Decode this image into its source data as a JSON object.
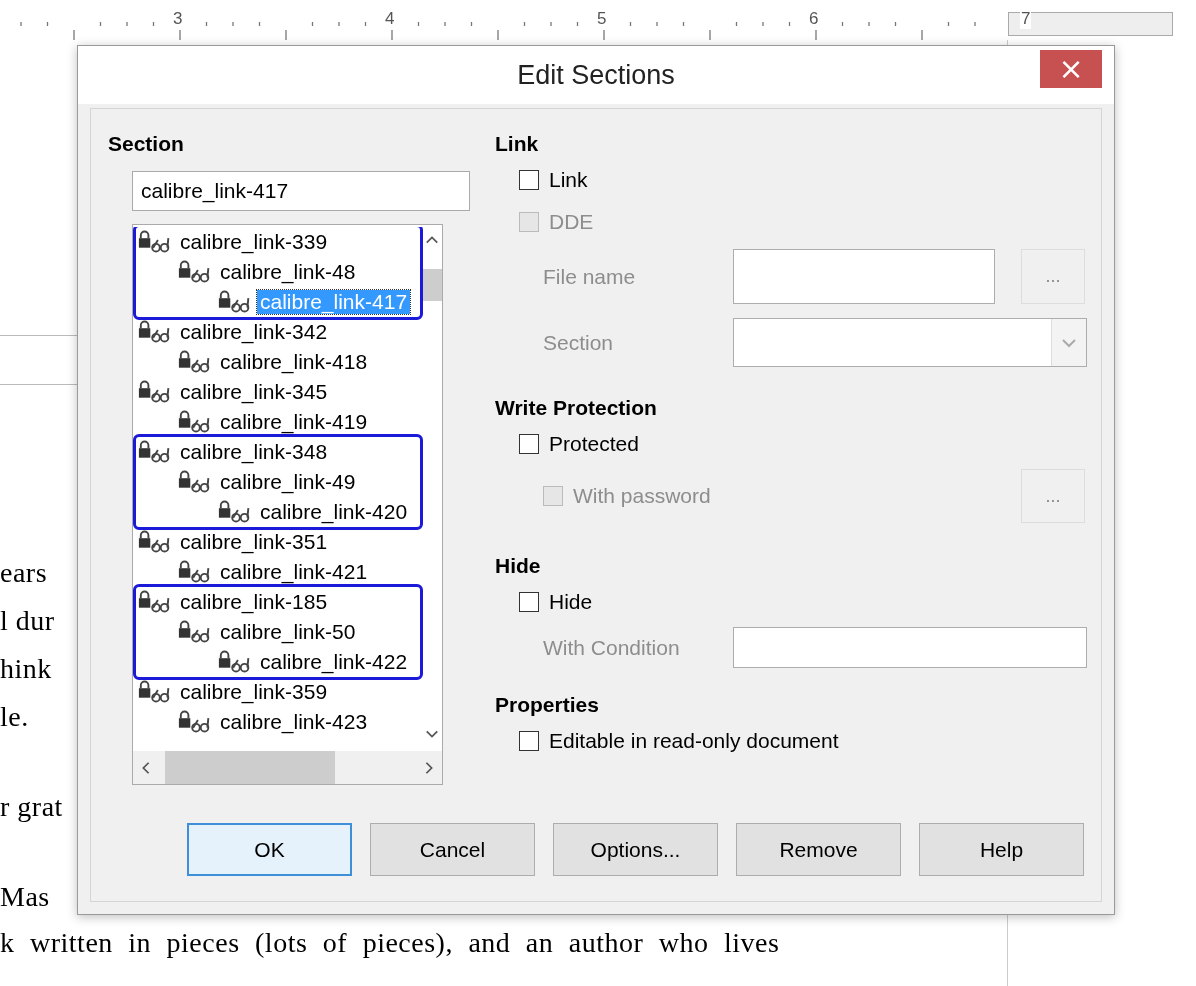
{
  "ruler": {
    "numbers": [
      "3",
      "4",
      "5",
      "6",
      "7"
    ]
  },
  "document": {
    "lines": [
      "ears",
      "l dur",
      "hink",
      "le.",
      "r grat",
      "Mas",
      "k written in pieces (lots of pieces), and an author who lives"
    ]
  },
  "dialog": {
    "title": "Edit Sections",
    "close": "×",
    "section": {
      "heading": "Section",
      "name_value": "calibre_link-417",
      "tree": [
        {
          "label": "calibre_link-339",
          "selected": false,
          "annotated": true,
          "children": [
            {
              "label": "calibre_link-48",
              "selected": false,
              "children": [
                {
                  "label": "calibre_link-417",
                  "selected": true
                }
              ]
            }
          ]
        },
        {
          "label": "calibre_link-342",
          "selected": false,
          "annotated": false,
          "children": [
            {
              "label": "calibre_link-418",
              "selected": false
            }
          ]
        },
        {
          "label": "calibre_link-345",
          "selected": false,
          "annotated": false,
          "children": [
            {
              "label": "calibre_link-419",
              "selected": false
            }
          ]
        },
        {
          "label": "calibre_link-348",
          "selected": false,
          "annotated": true,
          "children": [
            {
              "label": "calibre_link-49",
              "selected": false,
              "children": [
                {
                  "label": "calibre_link-420",
                  "selected": false
                }
              ]
            }
          ]
        },
        {
          "label": "calibre_link-351",
          "selected": false,
          "annotated": false,
          "children": [
            {
              "label": "calibre_link-421",
              "selected": false
            }
          ]
        },
        {
          "label": "calibre_link-185",
          "selected": false,
          "annotated": true,
          "children": [
            {
              "label": "calibre_link-50",
              "selected": false,
              "children": [
                {
                  "label": "calibre_link-422",
                  "selected": false
                }
              ]
            }
          ]
        },
        {
          "label": "calibre_link-359",
          "selected": false,
          "annotated": false,
          "children": [
            {
              "label": "calibre_link-423",
              "selected": false
            }
          ]
        }
      ]
    },
    "link": {
      "heading": "Link",
      "options": [
        {
          "label": "Link",
          "checked": false,
          "disabled": false
        },
        {
          "label": "DDE",
          "checked": false,
          "disabled": true
        }
      ],
      "file_name": {
        "label": "File name",
        "disabled": true,
        "button": "..."
      },
      "section": {
        "label": "Section",
        "disabled": true
      }
    },
    "write_protection": {
      "heading": "Write Protection",
      "protected": {
        "label": "Protected",
        "checked": false,
        "disabled": false
      },
      "password": {
        "label": "With password",
        "checked": false,
        "disabled": true,
        "button": "..."
      }
    },
    "hide": {
      "heading": "Hide",
      "hide": {
        "label": "Hide",
        "checked": false,
        "disabled": false
      },
      "condition": {
        "label": "With Condition",
        "disabled": true
      }
    },
    "properties": {
      "heading": "Properties",
      "editable": {
        "label": "Editable in read-only document",
        "checked": false,
        "disabled": false
      }
    },
    "buttons": [
      {
        "label": "OK",
        "focused": true
      },
      {
        "label": "Cancel",
        "focused": false
      },
      {
        "label": "Options...",
        "focused": false
      },
      {
        "label": "Remove",
        "focused": false
      },
      {
        "label": "Help",
        "focused": false
      }
    ]
  }
}
